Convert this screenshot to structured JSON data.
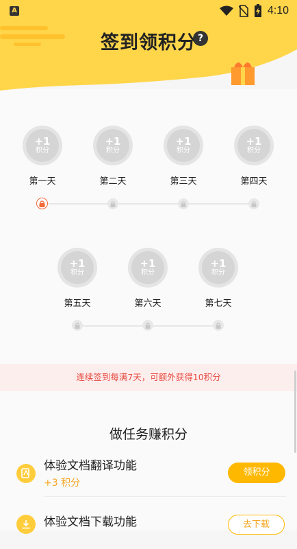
{
  "status_bar": {
    "app_badge": "A",
    "time": "4:10"
  },
  "header": {
    "title": "签到领积分",
    "help": "?"
  },
  "days_row1": [
    {
      "plus": "+1",
      "unit": "积分",
      "label": "第一天"
    },
    {
      "plus": "+1",
      "unit": "积分",
      "label": "第二天"
    },
    {
      "plus": "+1",
      "unit": "积分",
      "label": "第三天"
    },
    {
      "plus": "+1",
      "unit": "积分",
      "label": "第四天"
    }
  ],
  "days_row2": [
    {
      "plus": "+1",
      "unit": "积分",
      "label": "第五天"
    },
    {
      "plus": "+1",
      "unit": "积分",
      "label": "第六天"
    },
    {
      "plus": "+1",
      "unit": "积分",
      "label": "第七天"
    }
  ],
  "notice": "连续签到每满7天，可额外获得10积分",
  "tasks": {
    "title": "做任务赚积分",
    "items": [
      {
        "name": "体验文档翻译功能",
        "reward": "+3 积分",
        "button": "领积分"
      },
      {
        "name": "体验文档下载功能",
        "button": "去下载"
      }
    ]
  },
  "colors": {
    "accent": "#ffb800",
    "header": "#ffd54a",
    "active_lock": "#f26b3a",
    "notice_text": "#e64a3f"
  }
}
